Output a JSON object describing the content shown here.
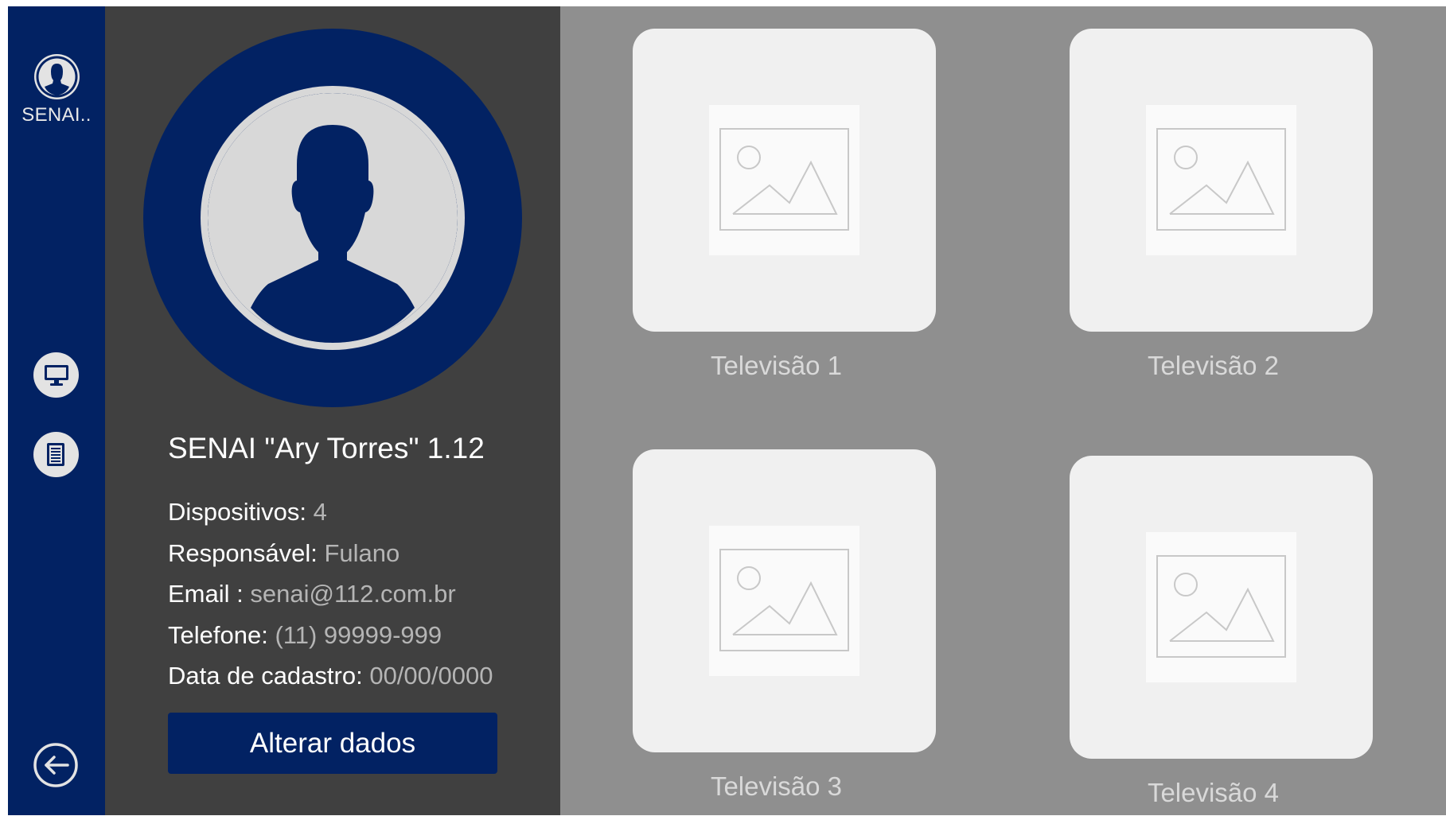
{
  "sidebar": {
    "user_label": "SENAI..",
    "items": [
      {
        "name": "monitor-icon"
      },
      {
        "name": "document-icon"
      }
    ],
    "logout_icon": "logout-icon"
  },
  "profile": {
    "title": "SENAI \"Ary Torres\" 1.12",
    "fields": [
      {
        "label": "Dispositivos: ",
        "value": "4"
      },
      {
        "label": "Responsável: ",
        "value": "Fulano"
      },
      {
        "label": "Email : ",
        "value": "senai@112.com.br"
      },
      {
        "label": "Telefone: ",
        "value": "(11) 99999-999"
      },
      {
        "label": "Data de cadastro: ",
        "value": "00/00/0000"
      }
    ],
    "edit_button": "Alterar dados"
  },
  "devices": [
    {
      "name": "Televisão 1"
    },
    {
      "name": "Televisão 2"
    },
    {
      "name": "Televisão 3"
    },
    {
      "name": "Televisão 4"
    }
  ],
  "colors": {
    "sidebar": "#022263",
    "panel": "#404040",
    "main": "#8f8f8f",
    "card": "#f0f0f0"
  }
}
